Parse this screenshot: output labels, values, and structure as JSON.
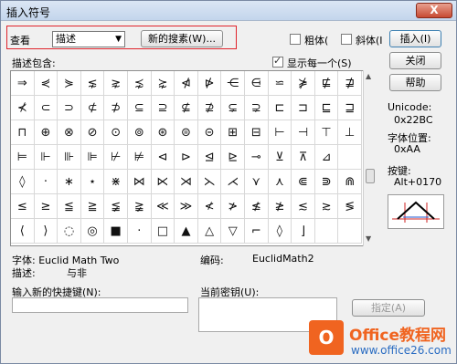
{
  "window": {
    "title": "插入符号",
    "close": "X"
  },
  "toolbar": {
    "view_label": "查看",
    "view_select": "描述",
    "new_search_button": "新的搜素(W)...",
    "bold_label": "粗体(",
    "italic_label": "斜体(I",
    "insert_button": "插入(I)"
  },
  "side": {
    "close_button": "关闭",
    "help_button": "帮助",
    "unicode_label": "Unicode:",
    "unicode_value": "0x22BC",
    "font_pos_label": "字体位置:",
    "font_pos_value": "0xAA",
    "key_label": "按键:",
    "key_value": "Alt+0170"
  },
  "grid": {
    "label": "描述包含:",
    "show_each_label": "显示每一个(S)",
    "rows": [
      [
        "⇒",
        "⋞",
        "⋟",
        "⋦",
        "⋧",
        "⋨",
        "⋩",
        "⋪",
        "⋫",
        "⋲",
        "⋳",
        "⋍",
        "⋡",
        "⋢",
        "⋣"
      ],
      [
        "⊀",
        "⊂",
        "⊃",
        "⊄",
        "⊅",
        "⊆",
        "⊇",
        "⊈",
        "⊉",
        "⊊",
        "⊋",
        "⊏",
        "⊐",
        "⊑",
        "⊒"
      ],
      [
        "⊓",
        "⊕",
        "⊗",
        "⊘",
        "⊙",
        "⊚",
        "⊛",
        "⊜",
        "⊝",
        "⊞",
        "⊟",
        "⊢",
        "⊣",
        "⊤",
        "⊥"
      ],
      [
        "⊨",
        "⊩",
        "⊪",
        "⊫",
        "⊬",
        "⊭",
        "⊲",
        "⊳",
        "⊴",
        "⊵",
        "⊸",
        "⊻",
        "⊼",
        "⊿",
        ""
      ],
      [
        "◊",
        "·",
        "∗",
        "⋆",
        "⋇",
        "⋈",
        "⋉",
        "⋊",
        "⋋",
        "⋌",
        "⋎",
        "⋏",
        "⋐",
        "⋑",
        "⋒"
      ],
      [
        "≤",
        "≥",
        "≦",
        "≧",
        "≨",
        "≩",
        "≪",
        "≫",
        "≮",
        "≯",
        "≰",
        "≱",
        "≲",
        "≳",
        "≶"
      ],
      [
        "⟨",
        "⟩",
        "◌",
        "◎",
        "■",
        "·",
        "□",
        "▲",
        "△",
        "▽",
        "⌐",
        "◊",
        "⌋",
        "",
        ""
      ]
    ]
  },
  "font_info": {
    "font_label": "字体: Euclid Math Two",
    "code_label": "编码:",
    "code_value": "EuclidMath2",
    "desc_label": "描述:",
    "desc_value": "与非"
  },
  "shortcut": {
    "new_key_label": "输入新的快捷键(N):",
    "current_key_label": "当前密钥(U):",
    "assign_button": "指定(A)"
  },
  "watermark": {
    "logo_letter": "O",
    "title": "Office教程网",
    "url": "www.office26.com"
  }
}
